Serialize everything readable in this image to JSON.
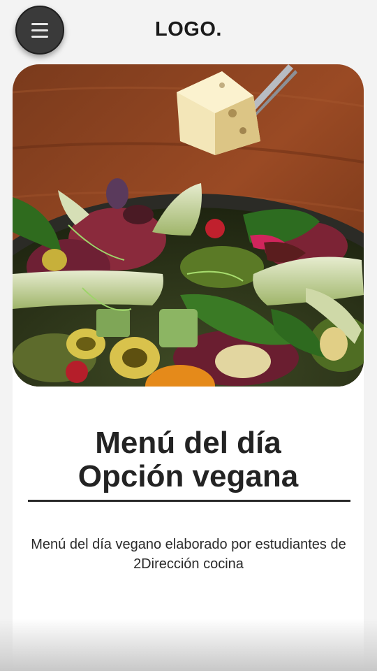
{
  "header": {
    "menu_icon": "hamburger-menu-icon",
    "logo_text": "LOGO."
  },
  "hero": {
    "image_name": "vegan-salad-photo"
  },
  "main": {
    "title_line_1": "Menú del día",
    "title_line_2": "Opción vegana",
    "description": "Menú del día vegano elaborado por estudiantes de 2Dirección cocina"
  },
  "colors": {
    "background": "#f3f3f3",
    "card": "#ffffff",
    "menu_button": "#3a3a3a",
    "text": "#232323"
  }
}
